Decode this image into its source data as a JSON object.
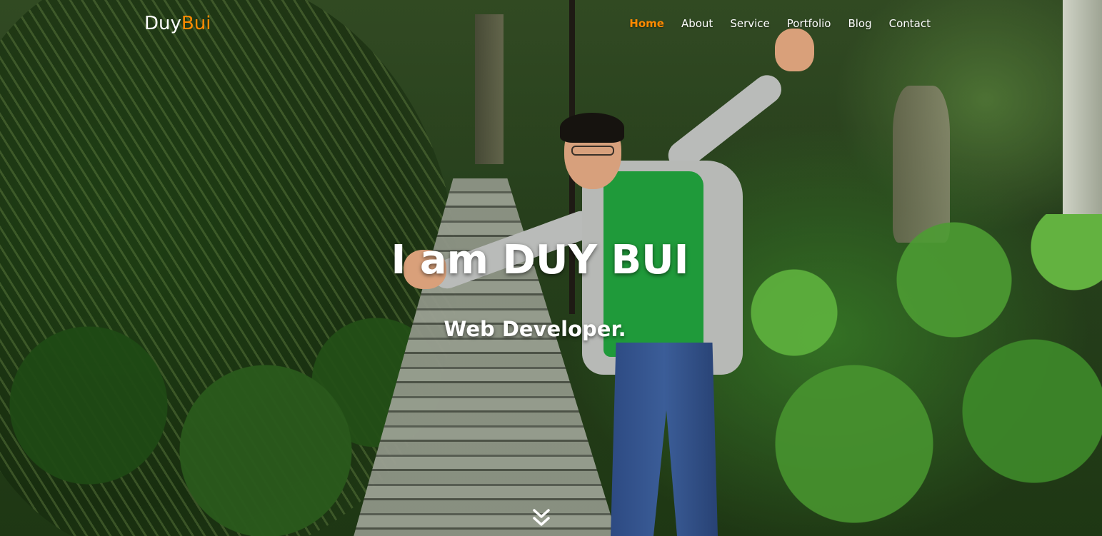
{
  "brand": {
    "prefix": "Duy",
    "suffix": "Bui",
    "accent_color": "#ff8a00"
  },
  "nav": {
    "items": [
      {
        "label": "Home",
        "active": true
      },
      {
        "label": "About",
        "active": false
      },
      {
        "label": "Service",
        "active": false
      },
      {
        "label": "Portfolio",
        "active": false
      },
      {
        "label": "Blog",
        "active": false
      },
      {
        "label": "Contact",
        "active": false
      }
    ]
  },
  "hero": {
    "headline": "I am DUY BUI",
    "subheadline": "Web Developer.",
    "background_image": "photo of a man smiling with arms outstretched on a wooden jungle walkway",
    "scroll_icon": "double-chevron-down-icon"
  },
  "colors": {
    "text": "#ffffff",
    "accent": "#ff8a00"
  }
}
